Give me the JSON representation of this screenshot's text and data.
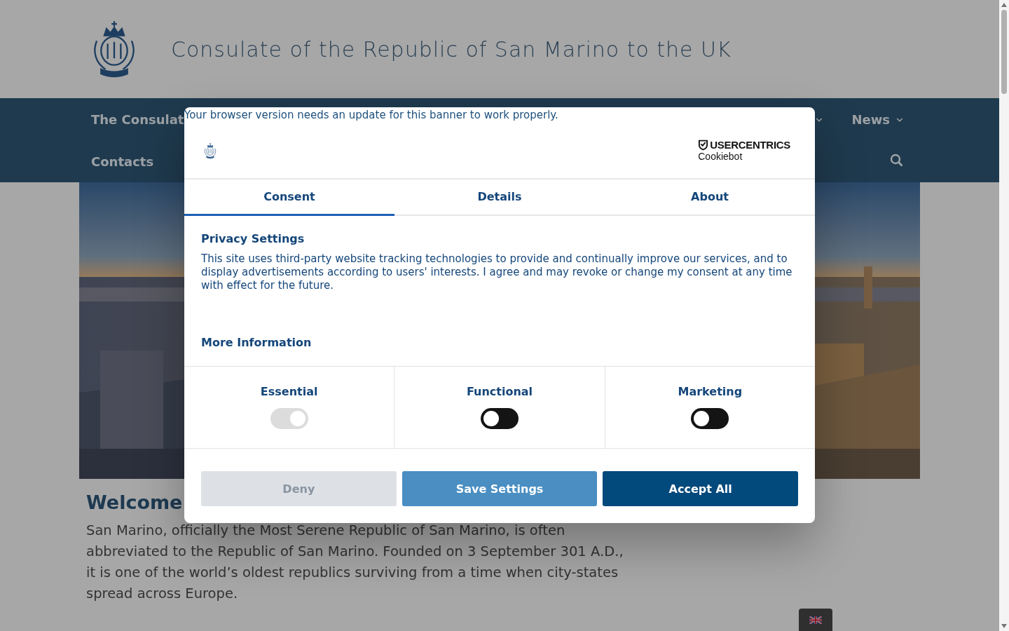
{
  "site": {
    "title": "Consulate of the Republic of San Marino to the UK"
  },
  "nav": {
    "rows": [
      [
        {
          "label": "The Consulat",
          "has_menu": false
        },
        {
          "has_menu": true
        },
        {
          "label": "News",
          "has_menu": true
        }
      ],
      [
        {
          "label": "Contacts",
          "has_menu": false
        }
      ]
    ]
  },
  "intro": {
    "heading": "Welcome",
    "text": "San Marino, officially the Most Serene Republic of San Marino, is often abbreviated to the Republic of San Marino. Founded on 3 September 301 A.D., it is one of the world’s oldest republics surviving from a time when city-states spread across Europe."
  },
  "cookie_dialog": {
    "notice": "Your browser version needs an update for this banner to work properly.",
    "brand": {
      "name": "USERCENTRICS",
      "product": "Cookiebot"
    },
    "tabs": [
      {
        "label": "Consent",
        "selected": true
      },
      {
        "label": "Details",
        "selected": false
      },
      {
        "label": "About",
        "selected": false
      }
    ],
    "heading": "Privacy Settings",
    "text": "This site uses third-party website tracking technologies to provide and continually improve our services, and to display advertisements according to users' interests. I agree and may revoke or change my consent at any time with effect for the future.",
    "more_link": "More Information",
    "categories": [
      {
        "label": "Essential",
        "on": true,
        "disabled": true
      },
      {
        "label": "Functional",
        "on": false,
        "disabled": false
      },
      {
        "label": "Marketing",
        "on": false,
        "disabled": false
      }
    ],
    "buttons": [
      {
        "label": "Deny",
        "kind": "muted"
      },
      {
        "label": "Save Settings",
        "kind": "secondary"
      },
      {
        "label": "Accept All",
        "kind": "primary"
      }
    ]
  }
}
